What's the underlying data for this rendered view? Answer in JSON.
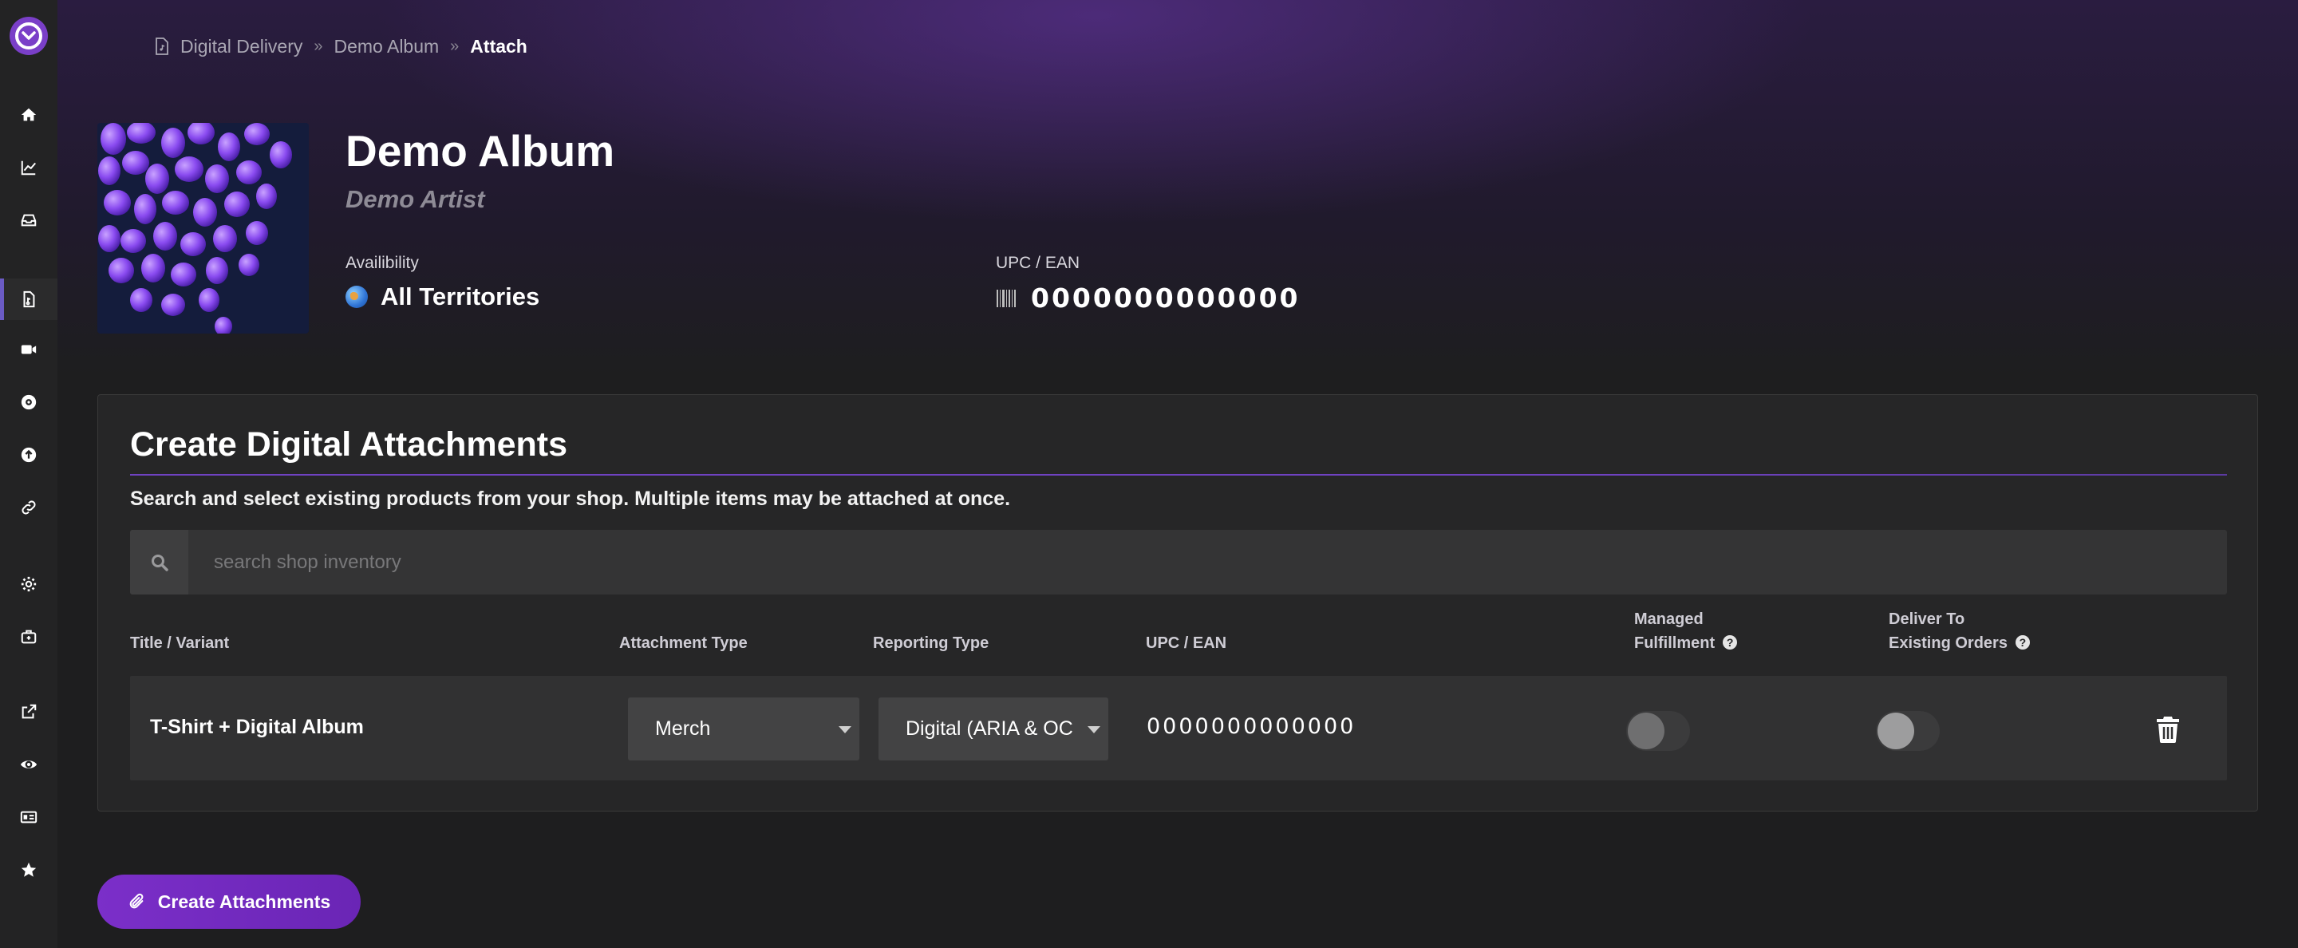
{
  "breadcrumb": [
    "Digital Delivery",
    "Demo Album",
    "Attach"
  ],
  "album": {
    "title": "Demo Album",
    "artist": "Demo Artist",
    "availability_label": "Availibility",
    "availability_value": "All Territories",
    "upc_label": "UPC / EAN",
    "upc_value": "0000000000000"
  },
  "sidebar": {
    "icons": [
      "home-icon",
      "chart-icon",
      "inbox-icon",
      "file-audio-icon",
      "video-icon",
      "disc-icon",
      "upload-icon",
      "link-icon",
      "gear-icon",
      "briefcase-icon",
      "external-link-icon",
      "eye-icon",
      "id-card-icon",
      "star-icon"
    ],
    "active": "file-audio-icon"
  },
  "panel": {
    "title": "Create Digital Attachments",
    "description": "Search and select existing products from your shop. Multiple items may be attached at once.",
    "search_placeholder": "search shop inventory",
    "columns": {
      "title_variant": "Title / Variant",
      "attachment_type": "Attachment Type",
      "reporting_type": "Reporting Type",
      "upc": "UPC / EAN",
      "managed_1": "Managed",
      "managed_2": "Fulfillment",
      "deliver_1": "Deliver To",
      "deliver_2": "Existing Orders"
    },
    "row": {
      "title": "T-Shirt + Digital Album",
      "attachment_type": "Merch",
      "reporting_type": "Digital (ARIA & OC",
      "upc": "0000000000000",
      "managed_fulfillment": false,
      "deliver_existing": false
    }
  },
  "actions": {
    "create_label": "Create Attachments"
  },
  "colors": {
    "accent": "#7b2fc9",
    "active_bar": "#6b5bc4",
    "background": "#1e1e1f"
  }
}
